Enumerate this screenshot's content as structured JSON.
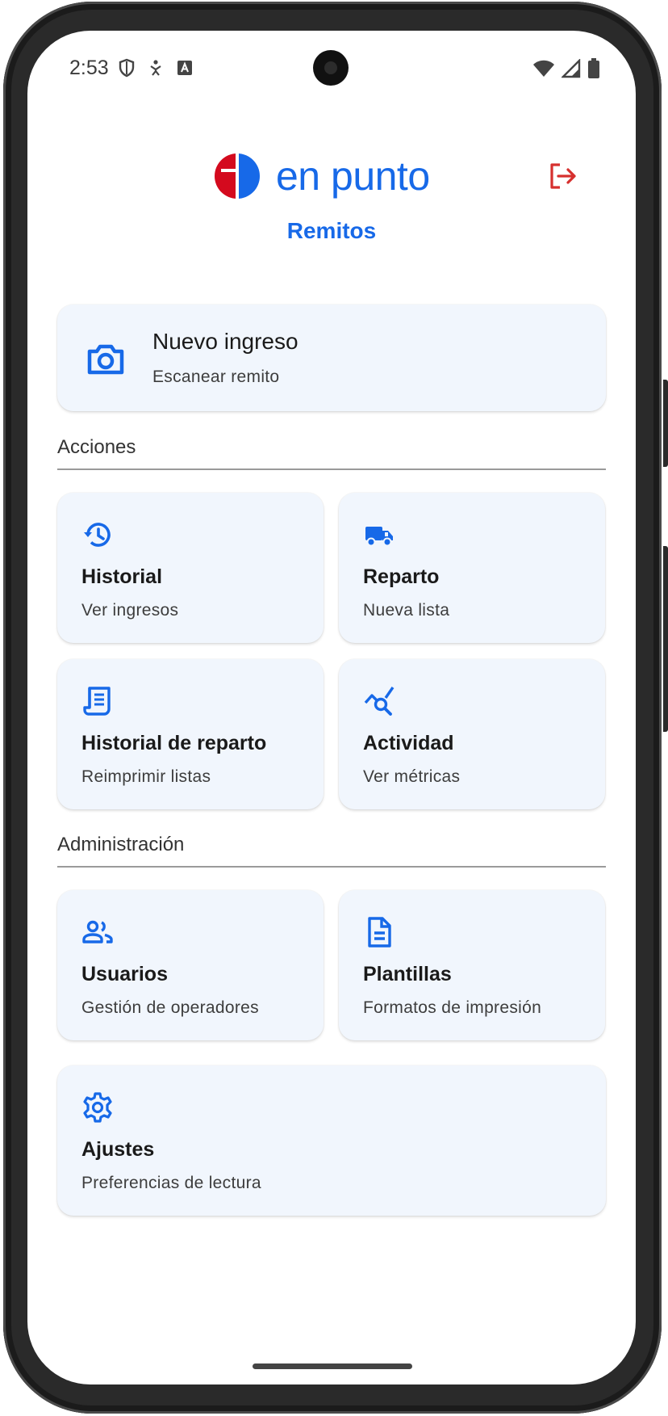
{
  "status_bar": {
    "time": "2:53"
  },
  "header": {
    "logo_text": "en punto",
    "app_title": "Remitos"
  },
  "primary_action": {
    "title": "Nuevo ingreso",
    "subtitle": "Escanear remito",
    "icon": "camera-icon"
  },
  "sections": {
    "actions": {
      "label": "Acciones",
      "items": [
        {
          "title": "Historial",
          "subtitle": "Ver ingresos",
          "icon": "history-icon"
        },
        {
          "title": "Reparto",
          "subtitle": "Nueva lista",
          "icon": "truck-icon"
        },
        {
          "title": "Historial de reparto",
          "subtitle": "Reimprimir listas",
          "icon": "receipt-icon"
        },
        {
          "title": "Actividad",
          "subtitle": "Ver métricas",
          "icon": "query-stats-icon"
        }
      ]
    },
    "admin": {
      "label": "Administración",
      "items": [
        {
          "title": "Usuarios",
          "subtitle": "Gestión de operadores",
          "icon": "users-icon"
        },
        {
          "title": "Plantillas",
          "subtitle": "Formatos de impresión",
          "icon": "document-icon"
        },
        {
          "title": "Ajustes",
          "subtitle": "Preferencias de lectura",
          "icon": "gear-icon"
        }
      ]
    }
  },
  "colors": {
    "accent": "#1769e8",
    "logout": "#d6302e",
    "logo_red": "#d40a1e",
    "card_bg": "#f1f6fd"
  }
}
